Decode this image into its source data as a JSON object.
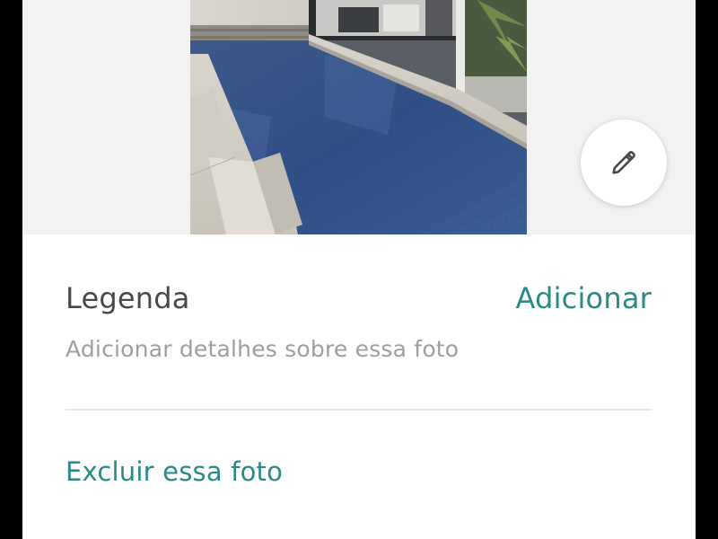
{
  "photo": {
    "alt_icon": "pool-photo"
  },
  "edit_button": {
    "icon": "pencil-icon"
  },
  "caption": {
    "label": "Legenda",
    "add_label": "Adicionar",
    "placeholder": "Adicionar detalhes sobre essa foto"
  },
  "actions": {
    "delete_label": "Excluir essa foto"
  },
  "colors": {
    "accent": "#2a8a88",
    "text_primary": "#484848",
    "text_secondary": "#9e9e9e",
    "divider": "#e8e8e8",
    "photo_background": "#f2f2f2"
  }
}
